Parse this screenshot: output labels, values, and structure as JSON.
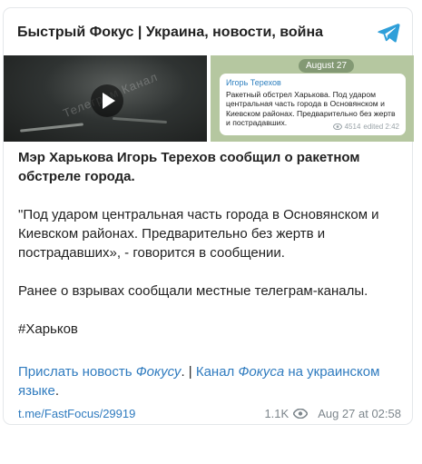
{
  "header": {
    "channel_title": "Быстрый Фокус | Украина, новости, война"
  },
  "media": {
    "video": {
      "watermark": "Телеграм Канал"
    },
    "screenshot": {
      "date_label": "August 27",
      "author": "Игорь Терехов",
      "text": "Ракетный обстрел Харькова. Под ударом центральная часть города в Основянском и Киевском районах. Предварительно без жертв и пострадавших.",
      "views": "4514",
      "edited": "edited 2:42"
    }
  },
  "post": {
    "lead": "Мэр Харькова Игорь Терехов сообщил о ракетном обстреле города.",
    "quote": "\"Под ударом центральная часть города в Основянском и Киевском районах. Предварительно без жертв и пострадавших», - говорится в сообщении.",
    "body": "Ранее о взрывах сообщали местные телеграм-каналы.",
    "hashtag": "#Харьков"
  },
  "links": {
    "send_news_prefix": "Прислать новость ",
    "send_news_name": "Фокусу",
    "separator": ". | ",
    "channel_prefix": "Канал ",
    "channel_name": "Фокуса",
    "channel_suffix": " на украинском языке",
    "end": "."
  },
  "footer": {
    "post_link": "t.me/FastFocus/29919",
    "views": "1.1K",
    "date": "Aug 27 at 02:58"
  },
  "colors": {
    "link": "#2f7bbf",
    "telegram": "#2f9fd9",
    "meta": "#7d868c"
  }
}
